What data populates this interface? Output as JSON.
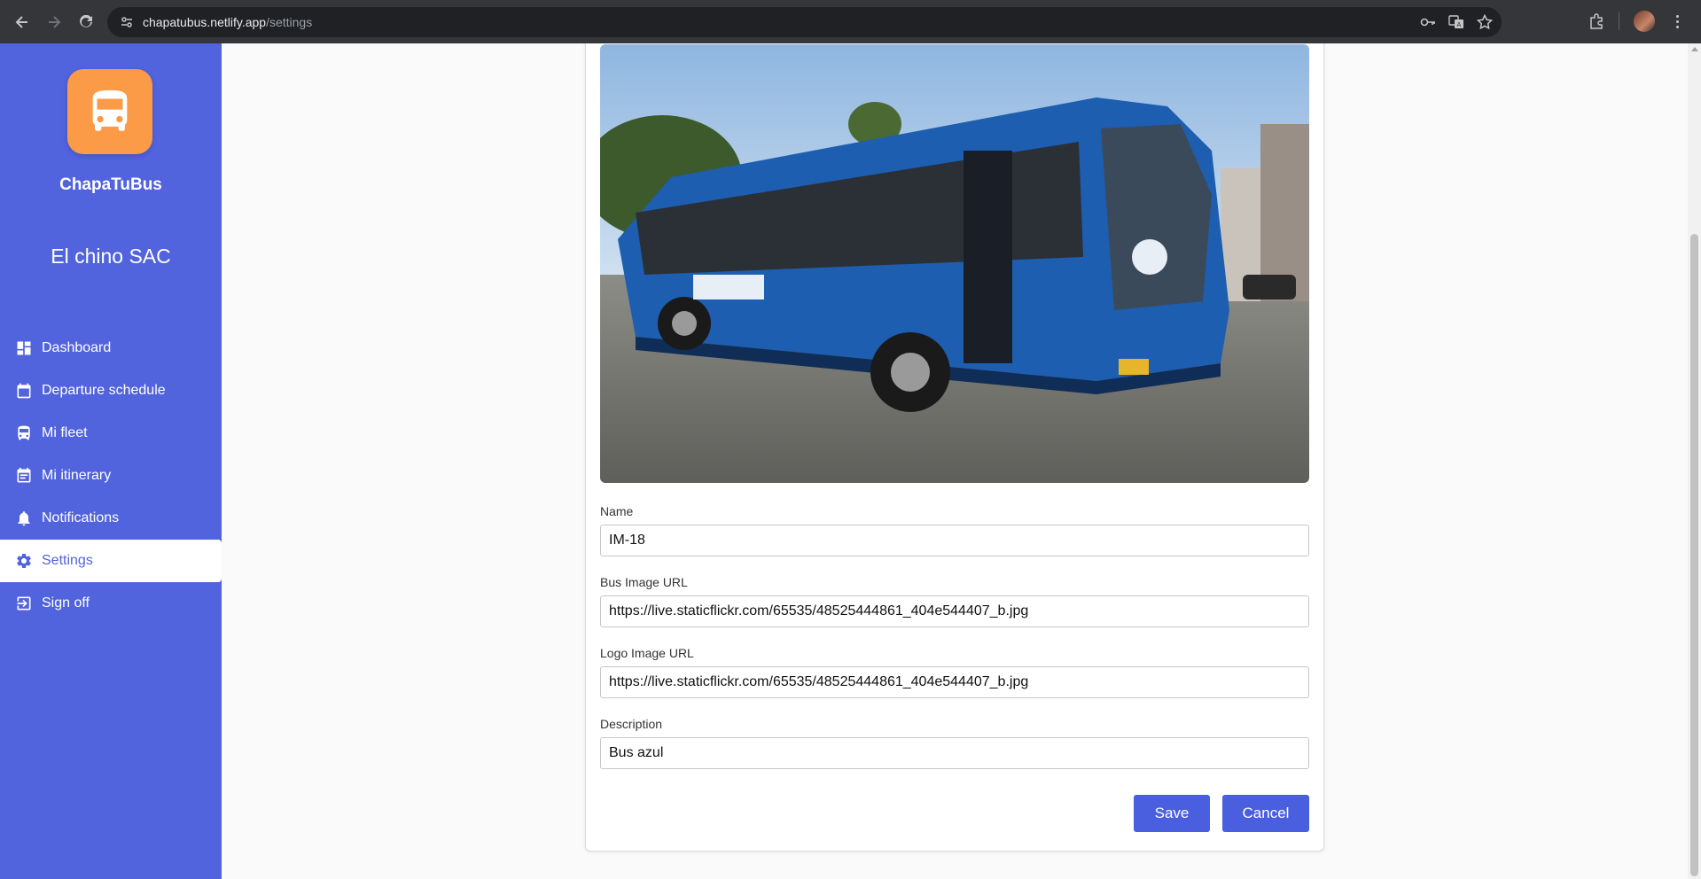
{
  "browser": {
    "url_host": "chapatubus.netlify.app",
    "url_path": "/settings"
  },
  "sidebar": {
    "brand": "ChapaTuBus",
    "company": "El chino SAC",
    "items": [
      {
        "label": "Dashboard",
        "icon": "dashboard-icon"
      },
      {
        "label": "Departure schedule",
        "icon": "calendar-icon"
      },
      {
        "label": "Mi fleet",
        "icon": "bus-icon"
      },
      {
        "label": "Mi itinerary",
        "icon": "event-note-icon"
      },
      {
        "label": "Notifications",
        "icon": "bell-icon"
      },
      {
        "label": "Settings",
        "icon": "gear-icon",
        "active": true
      },
      {
        "label": "Sign off",
        "icon": "logout-icon"
      }
    ]
  },
  "form": {
    "name_label": "Name",
    "name_value": "IM-18",
    "bus_image_label": "Bus Image URL",
    "bus_image_value": "https://live.staticflickr.com/65535/48525444861_404e544407_b.jpg",
    "logo_image_label": "Logo Image URL",
    "logo_image_value": "https://live.staticflickr.com/65535/48525444861_404e544407_b.jpg",
    "description_label": "Description",
    "description_value": "Bus azul",
    "save_label": "Save",
    "cancel_label": "Cancel"
  },
  "colors": {
    "sidebar": "#5163dd",
    "logo": "#fb9a47",
    "button": "#4a5ee0"
  }
}
